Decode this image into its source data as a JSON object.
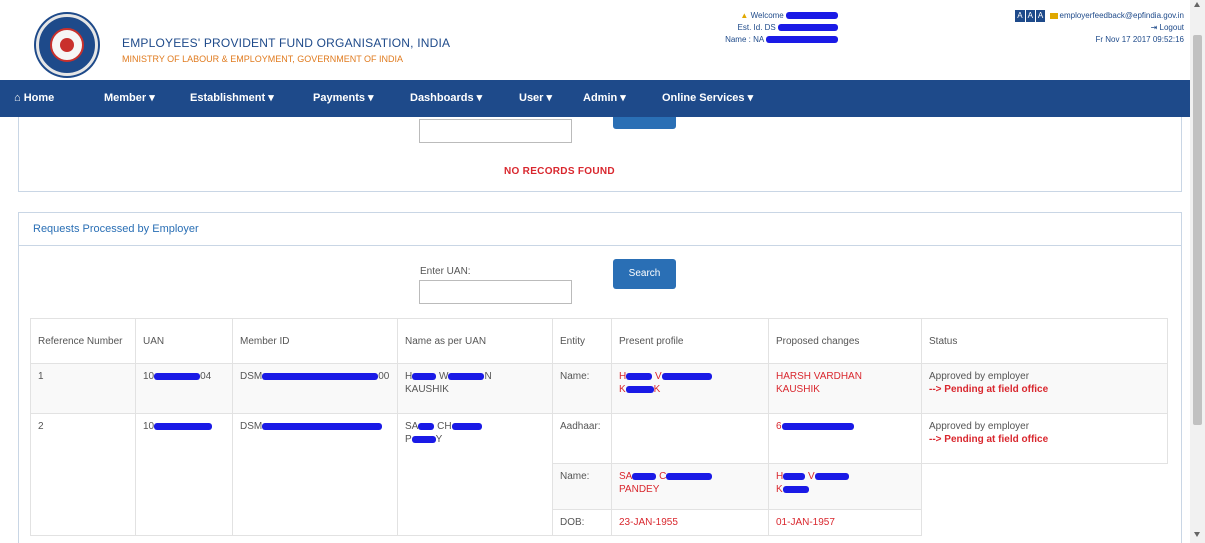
{
  "header": {
    "org_name": "EMPLOYEES' PROVIDENT FUND ORGANISATION, INDIA",
    "ministry": "MINISTRY OF LABOUR & EMPLOYMENT, GOVERNMENT OF INDIA",
    "welcome_label": "Welcome",
    "est_label": "Est. Id. DS",
    "name_label": "Name : NA",
    "font_buttons": [
      "A",
      "A",
      "A"
    ],
    "email": "employerfeedback@epfindia.gov.in",
    "logout_label": "Logout",
    "login_time": "Fr Nov 17 2017 09:52:16"
  },
  "nav": {
    "items": [
      {
        "label": "Home",
        "icon": "home-icon"
      },
      {
        "label": "Member"
      },
      {
        "label": "Establishment"
      },
      {
        "label": "Payments"
      },
      {
        "label": "Dashboards"
      },
      {
        "label": "User"
      },
      {
        "label": "Admin"
      },
      {
        "label": "Online Services"
      }
    ],
    "dropdown_glyph": "▾",
    "home_glyph": "⌂"
  },
  "top_panel": {
    "no_records": "NO RECORDS FOUND"
  },
  "processed": {
    "title": "Requests Processed by Employer",
    "uan_label": "Enter UAN:",
    "search_label": "Search",
    "columns": [
      "Reference Number",
      "UAN",
      "Member ID",
      "Name as per UAN",
      "Entity",
      "Present profile",
      "Proposed changes",
      "Status"
    ],
    "rows": [
      {
        "ref": "1",
        "uan": "10",
        "uan_tail": "04",
        "member_id": "DSM",
        "member_tail": "00",
        "name": "H",
        "name_tail": "N",
        "name2": "KAUSHIK",
        "entity": "Name:",
        "present": "H",
        "present_tail": "K",
        "proposed": "HARSH VARDHAN",
        "proposed2": "KAUSHIK",
        "status": "Approved by employer",
        "status2": "--> Pending at field office"
      },
      {
        "ref": "2",
        "uan": "10",
        "member_id": "DSM",
        "name": "SA",
        "name_mid": "CH",
        "name2": "P",
        "name2_tail": "Y",
        "status": "Approved by employer",
        "status2": "--> Pending at field office",
        "sub": [
          {
            "entity": "Aadhaar:",
            "present": "",
            "proposed": "6"
          },
          {
            "entity": "Name:",
            "present": "SA",
            "present_mid": "C",
            "present2": "PANDEY",
            "proposed": "H",
            "proposed_mid": "V",
            "proposed2": "K"
          },
          {
            "entity": "DOB:",
            "present": "23-JAN-1955",
            "proposed": "01-JAN-1957"
          }
        ]
      }
    ]
  },
  "colors": {
    "navbar": "#1e4a8a",
    "accent": "#2a6fb5",
    "alert": "#d9272e",
    "ministry": "#e07b1f",
    "redaction": "#1a1ae6"
  }
}
